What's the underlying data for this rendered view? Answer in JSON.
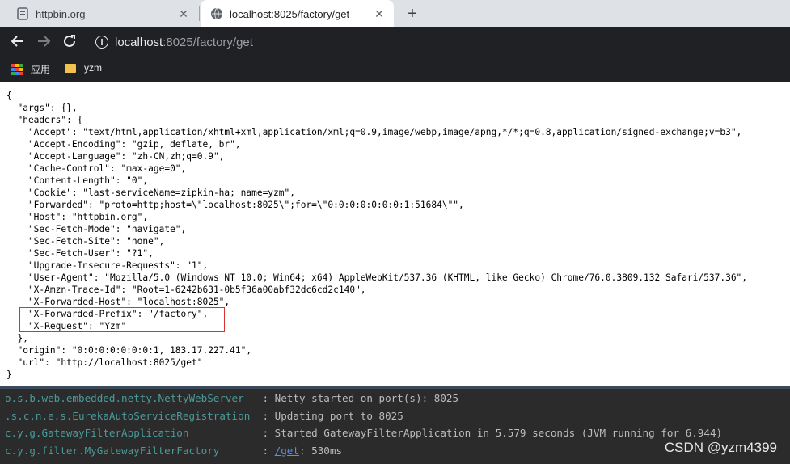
{
  "browser": {
    "tabs": [
      {
        "title": "httpbin.org",
        "active": false
      },
      {
        "title": "localhost:8025/factory/get",
        "active": true
      }
    ],
    "address": {
      "host": "localhost",
      "rest": ":8025/factory/get"
    },
    "bookmarks": [
      {
        "label": "应用",
        "icon": "apps-grid-icon"
      },
      {
        "label": "yzm",
        "icon": "folder-icon"
      }
    ]
  },
  "response_lines": [
    "{",
    "  \"args\": {},",
    "  \"headers\": {",
    "    \"Accept\": \"text/html,application/xhtml+xml,application/xml;q=0.9,image/webp,image/apng,*/*;q=0.8,application/signed-exchange;v=b3\",",
    "    \"Accept-Encoding\": \"gzip, deflate, br\",",
    "    \"Accept-Language\": \"zh-CN,zh;q=0.9\",",
    "    \"Cache-Control\": \"max-age=0\",",
    "    \"Content-Length\": \"0\",",
    "    \"Cookie\": \"last-serviceName=zipkin-ha; name=yzm\",",
    "    \"Forwarded\": \"proto=http;host=\\\"localhost:8025\\\";for=\\\"0:0:0:0:0:0:0:1:51684\\\"\",",
    "    \"Host\": \"httpbin.org\",",
    "    \"Sec-Fetch-Mode\": \"navigate\",",
    "    \"Sec-Fetch-Site\": \"none\",",
    "    \"Sec-Fetch-User\": \"?1\",",
    "    \"Upgrade-Insecure-Requests\": \"1\",",
    "    \"User-Agent\": \"Mozilla/5.0 (Windows NT 10.0; Win64; x64) AppleWebKit/537.36 (KHTML, like Gecko) Chrome/76.0.3809.132 Safari/537.36\",",
    "    \"X-Amzn-Trace-Id\": \"Root=1-6242b631-0b5f36a00abf32dc6cd2c140\",",
    "    \"X-Forwarded-Host\": \"localhost:8025\",",
    "    \"X-Forwarded-Prefix\": \"/factory\",",
    "    \"X-Request\": \"Yzm\"",
    "  },",
    "  \"origin\": \"0:0:0:0:0:0:0:1, 183.17.227.41\",",
    "  \"url\": \"http://localhost:8025/get\"",
    "}"
  ],
  "console_lines": [
    {
      "logger": "o.s.b.web.embedded.netty.NettyWebServer  ",
      "sep": " : ",
      "message": "Netty started on port(s): 8025",
      "link": ""
    },
    {
      "logger": ".s.c.n.e.s.EurekaAutoServiceRegistration ",
      "sep": " : ",
      "message": "Updating port to 8025",
      "link": ""
    },
    {
      "logger": "c.y.g.GatewayFilterApplication           ",
      "sep": " : ",
      "message": "Started GatewayFilterApplication in 5.579 seconds (JVM running for 6.944)",
      "link": ""
    },
    {
      "logger": "c.y.g.filter.MyGatewayFilterFactory      ",
      "sep": " : ",
      "message": ": 530ms",
      "link": "/get"
    }
  ],
  "watermark": "CSDN @yzm4399",
  "colors": {
    "highlight_box": "#d9332b",
    "console_logger": "#4a9a9a",
    "link": "#5394ec"
  }
}
